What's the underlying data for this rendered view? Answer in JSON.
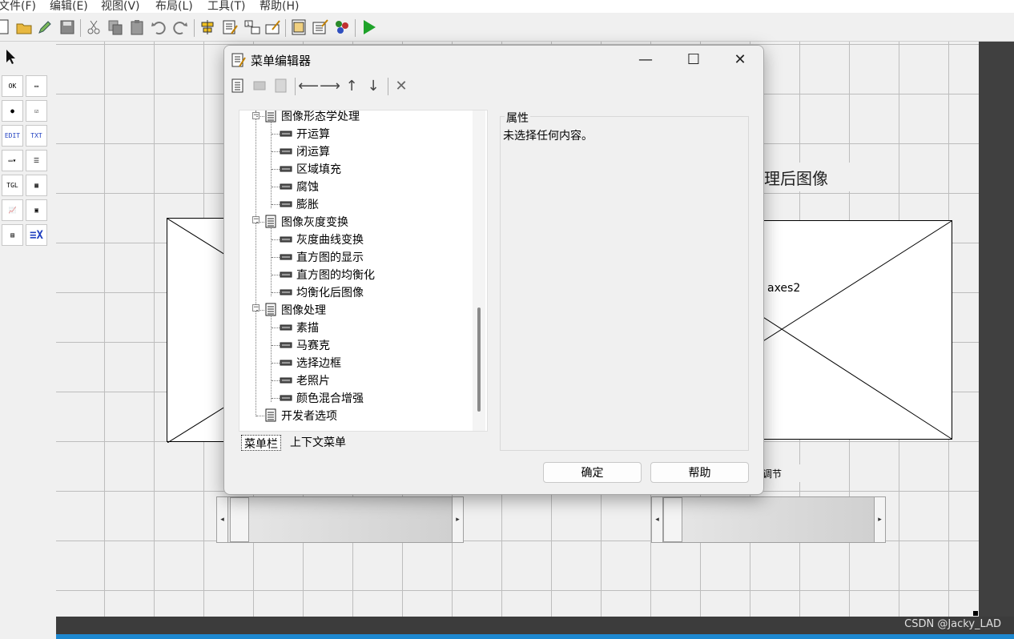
{
  "menubar": {
    "items": [
      "文件(F)",
      "编辑(E)",
      "视图(V)",
      "布局(L)",
      "工具(T)",
      "帮助(H)"
    ]
  },
  "canvas": {
    "title_partial": "理后图像",
    "axes2_label": "axes2",
    "slider_label_partial": "调节"
  },
  "dialog": {
    "title": "菜单编辑器",
    "tree": [
      {
        "label": "图像形态学处理",
        "level": 0
      },
      {
        "label": "开运算",
        "level": 1
      },
      {
        "label": "闭运算",
        "level": 1
      },
      {
        "label": "区域填充",
        "level": 1
      },
      {
        "label": "腐蚀",
        "level": 1
      },
      {
        "label": "膨胀",
        "level": 1
      },
      {
        "label": "图像灰度变换",
        "level": 0
      },
      {
        "label": "灰度曲线变换",
        "level": 1
      },
      {
        "label": "直方图的显示",
        "level": 1
      },
      {
        "label": "直方图的均衡化",
        "level": 1
      },
      {
        "label": "均衡化后图像",
        "level": 1
      },
      {
        "label": "图像处理",
        "level": 0
      },
      {
        "label": "素描",
        "level": 1
      },
      {
        "label": "马赛克",
        "level": 1
      },
      {
        "label": "选择边框",
        "level": 1
      },
      {
        "label": "老照片",
        "level": 1
      },
      {
        "label": "颜色混合增强",
        "level": 1
      },
      {
        "label": "开发者选项",
        "level": 0
      }
    ],
    "tabs": [
      "菜单栏",
      "上下文菜单"
    ],
    "properties": {
      "legend": "属性",
      "text": "未选择任何内容。"
    },
    "buttons": {
      "ok": "确定",
      "help": "帮助"
    }
  },
  "watermark": "CSDN @Jacky_LAD",
  "colors": {
    "run_green": "#1fa32a",
    "taskbar_blue": "#1d88d0"
  }
}
